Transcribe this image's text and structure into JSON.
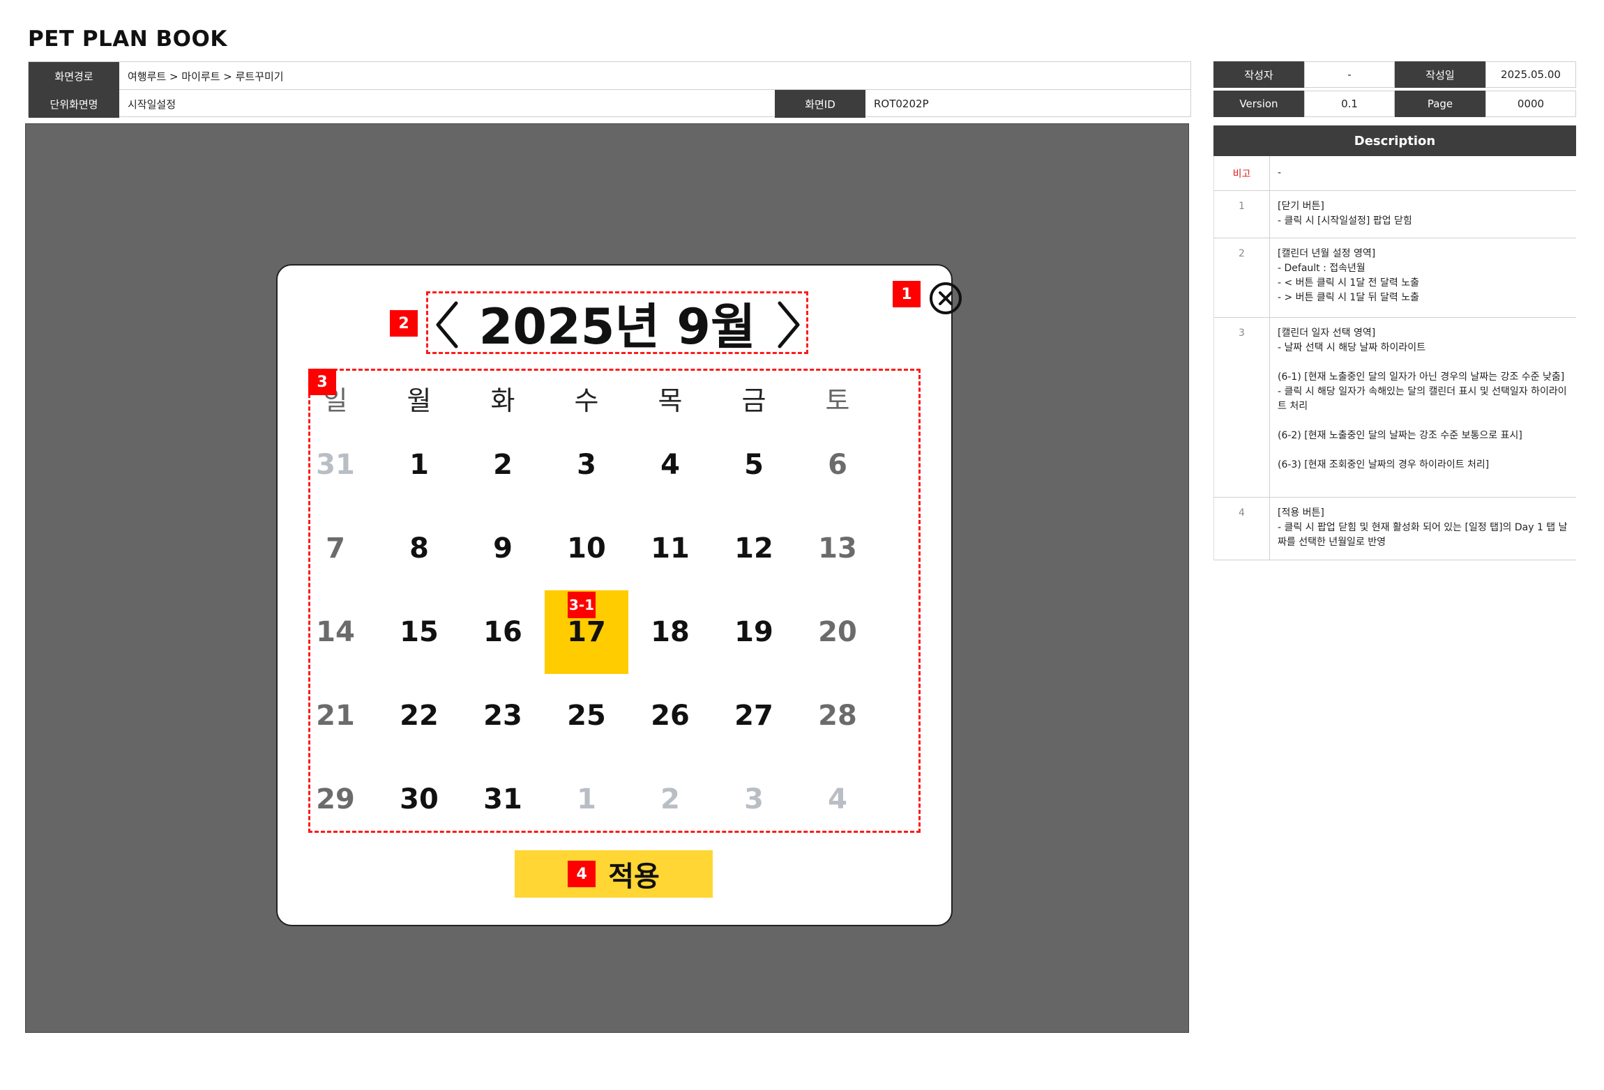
{
  "doc": {
    "title": "PET PLAN BOOK"
  },
  "info": {
    "path_label": "화면경로",
    "path_value": "여행루트 > 마이루트 > 루트꾸미기",
    "unit_label": "단위화면명",
    "unit_value": "시작일설정",
    "id_label": "화면ID",
    "id_value": "ROT0202P"
  },
  "meta": {
    "author_label": "작성자",
    "author_value": "-",
    "date_label": "작성일",
    "date_value": "2025.05.00",
    "version_label": "Version",
    "version_value": "0.1",
    "page_label": "Page",
    "page_value": "0000"
  },
  "calendar": {
    "month_title": "2025년 9월",
    "weekdays": [
      "일",
      "월",
      "화",
      "수",
      "목",
      "금",
      "토"
    ],
    "weeks": [
      [
        {
          "d": "31",
          "s": "outside"
        },
        {
          "d": "1",
          "s": "normal"
        },
        {
          "d": "2",
          "s": "normal"
        },
        {
          "d": "3",
          "s": "normal"
        },
        {
          "d": "4",
          "s": "normal"
        },
        {
          "d": "5",
          "s": "normal"
        },
        {
          "d": "6",
          "s": "weekend"
        }
      ],
      [
        {
          "d": "7",
          "s": "weekend"
        },
        {
          "d": "8",
          "s": "normal"
        },
        {
          "d": "9",
          "s": "normal"
        },
        {
          "d": "10",
          "s": "normal"
        },
        {
          "d": "11",
          "s": "normal"
        },
        {
          "d": "12",
          "s": "normal"
        },
        {
          "d": "13",
          "s": "weekend"
        }
      ],
      [
        {
          "d": "14",
          "s": "weekend"
        },
        {
          "d": "15",
          "s": "normal"
        },
        {
          "d": "16",
          "s": "normal"
        },
        {
          "d": "17",
          "s": "selected"
        },
        {
          "d": "18",
          "s": "normal"
        },
        {
          "d": "19",
          "s": "normal"
        },
        {
          "d": "20",
          "s": "weekend"
        }
      ],
      [
        {
          "d": "21",
          "s": "weekend"
        },
        {
          "d": "22",
          "s": "normal"
        },
        {
          "d": "23",
          "s": "normal"
        },
        {
          "d": "25",
          "s": "normal"
        },
        {
          "d": "26",
          "s": "normal"
        },
        {
          "d": "27",
          "s": "normal"
        },
        {
          "d": "28",
          "s": "weekend"
        }
      ],
      [
        {
          "d": "29",
          "s": "weekend"
        },
        {
          "d": "30",
          "s": "normal"
        },
        {
          "d": "31",
          "s": "normal"
        },
        {
          "d": "1",
          "s": "outside"
        },
        {
          "d": "2",
          "s": "outside"
        },
        {
          "d": "3",
          "s": "outside"
        },
        {
          "d": "4",
          "s": "outside"
        }
      ]
    ],
    "apply_label": "적용"
  },
  "markers": {
    "m1": "1",
    "m2": "2",
    "m3": "3",
    "m31": "3-1",
    "m4": "4"
  },
  "description": {
    "header": "Description",
    "rows": [
      {
        "num": "비고",
        "text": "-"
      },
      {
        "num": "1",
        "text": "[닫기 버튼]\n- 클릭 시 [시작일설정] 팝업 닫힘"
      },
      {
        "num": "2",
        "text": "[캘린더 년월 설정 영역]\n- Default : 접속년월\n- < 버튼 클릭 시 1달 전 달력 노출\n- > 버튼 클릭 시 1달 뒤 달력 노출"
      },
      {
        "num": "3",
        "text": "[캘린더 일자 선택 영역]\n- 날짜 선택 시 해당 날짜 하이라이트\n\n(6-1) [현재 노출중인 달의 일자가 아닌 경우의 날짜는 강조 수준 낮춤]\n- 클릭 시 해당 일자가 속해있는 달의 캘린더 표시 및 선택일자 하이라이트 처리\n\n(6-2) [현재 노출중인 달의 날짜는 강조 수준 보통으로 표시]\n\n(6-3) [현재 조회중인 날짜의 경우 하이라이트 처리]"
      },
      {
        "num": "4",
        "text": "[적용 버튼]\n- 클릭 시 팝업 닫힘 및 현재 활성화 되어 있는 [일정 탭]의 Day 1 탭 날짜를 선택한 년월일로 반영"
      }
    ]
  },
  "colors": {
    "highlight": "#ffcc00",
    "apply": "#ffd633",
    "marker": "#ff0000",
    "header_bg": "#3d3d3d",
    "canvas": "#666666"
  }
}
